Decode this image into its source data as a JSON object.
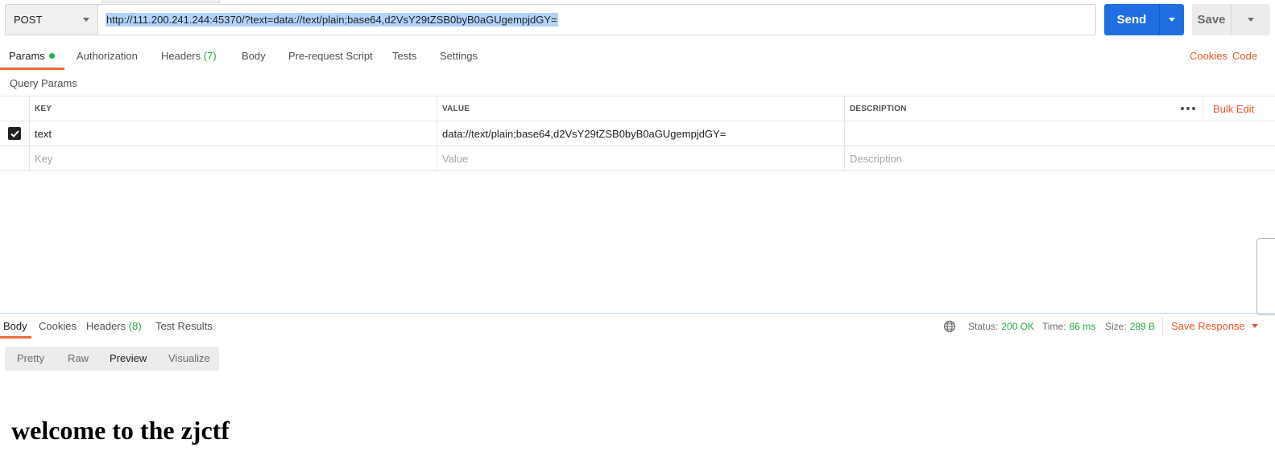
{
  "request": {
    "method": "POST",
    "url": "http://111.200.241.244:45370/?text=data://text/plain;base64,d2VsY29tZSB0byB0aGUgempjdGY=",
    "send_label": "Send",
    "save_label": "Save"
  },
  "request_tabs": {
    "params": "Params",
    "authorization": "Authorization",
    "headers": "Headers",
    "headers_count": "(7)",
    "body": "Body",
    "pre_request_script": "Pre-request Script",
    "tests": "Tests",
    "settings": "Settings",
    "cookies": "Cookies",
    "code": "Code"
  },
  "query_params": {
    "title": "Query Params",
    "columns": {
      "key": "KEY",
      "value": "VALUE",
      "description": "DESCRIPTION"
    },
    "bulk_edit": "Bulk Edit",
    "rows": [
      {
        "enabled": true,
        "key": "text",
        "value": "data://text/plain;base64,d2VsY29tZSB0byB0aGUgempjdGY=",
        "description": ""
      }
    ],
    "placeholders": {
      "key": "Key",
      "value": "Value",
      "description": "Description"
    }
  },
  "response_tabs": {
    "body": "Body",
    "cookies": "Cookies",
    "headers": "Headers",
    "headers_count": "(8)",
    "test_results": "Test Results"
  },
  "response_meta": {
    "status_label": "Status:",
    "status_value": "200 OK",
    "time_label": "Time:",
    "time_value": "86 ms",
    "size_label": "Size:",
    "size_value": "289 B",
    "save_response": "Save Response"
  },
  "view_modes": {
    "pretty": "Pretty",
    "raw": "Raw",
    "preview": "Preview",
    "visualize": "Visualize",
    "active": "Preview"
  },
  "preview": {
    "heading": "welcome to the zjctf"
  },
  "colors": {
    "send_button": "#1f6fe0",
    "accent_orange": "#e8542a",
    "status_green": "#26a641",
    "url_selection": "#b3d4fd"
  }
}
